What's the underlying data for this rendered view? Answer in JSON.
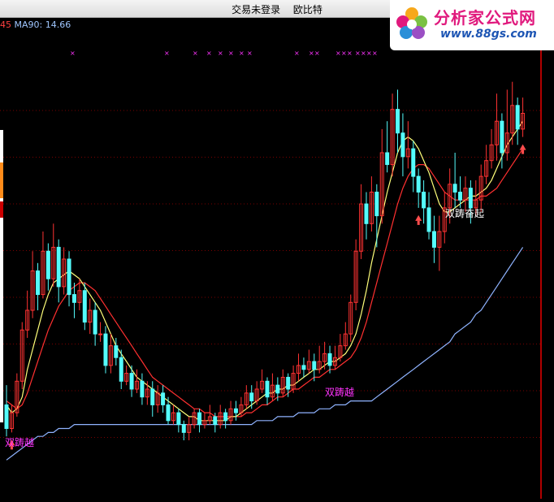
{
  "window": {
    "title_status": "交易未登录",
    "title_stock": "欧比特"
  },
  "indicator": {
    "prev_fragment": "45",
    "ma90_label": "MA90: 14.66"
  },
  "logo": {
    "brand": "分析家公式网",
    "url": "www.88gs.com"
  },
  "signals": {
    "label_a": "双踌越",
    "label_b": "双踌越",
    "label_c": "双踌奋起"
  },
  "colors": {
    "up": "#ff3232",
    "down": "#54fcfc",
    "ma_fast": "#ffff7a",
    "ma_mid": "#ff3030",
    "ma90": "#8fb3ff",
    "marker": "#ff33ff",
    "grid": "#7a0000"
  },
  "chart_data": {
    "type": "candlestick",
    "title": "",
    "xlabel": "",
    "ylabel": "",
    "ylim": [
      0,
      100
    ],
    "grid": true,
    "candles": [
      [
        16,
        10,
        21,
        8
      ],
      [
        10,
        14,
        16,
        9
      ],
      [
        14,
        22,
        24,
        13
      ],
      [
        22,
        35,
        37,
        20
      ],
      [
        35,
        40,
        45,
        33
      ],
      [
        40,
        50,
        55,
        38
      ],
      [
        50,
        44,
        52,
        40
      ],
      [
        44,
        55,
        60,
        43
      ],
      [
        55,
        48,
        57,
        45
      ],
      [
        48,
        56,
        62,
        46
      ],
      [
        56,
        46,
        58,
        42
      ],
      [
        46,
        53,
        56,
        44
      ],
      [
        53,
        44,
        55,
        41
      ],
      [
        44,
        42,
        47,
        38
      ],
      [
        42,
        45,
        48,
        40
      ],
      [
        45,
        37,
        47,
        35
      ],
      [
        37,
        40,
        43,
        34
      ],
      [
        40,
        34,
        42,
        31
      ],
      [
        34,
        34,
        37,
        32
      ],
      [
        34,
        26,
        36,
        24
      ],
      [
        26,
        31,
        34,
        24
      ],
      [
        31,
        28,
        33,
        26
      ],
      [
        28,
        22,
        30,
        20
      ],
      [
        22,
        24,
        26,
        21
      ],
      [
        24,
        20,
        26,
        18
      ],
      [
        20,
        22,
        25,
        19
      ],
      [
        22,
        18,
        24,
        16
      ],
      [
        18,
        20,
        22,
        16
      ],
      [
        20,
        16,
        22,
        13
      ],
      [
        16,
        19,
        21,
        14
      ],
      [
        19,
        16,
        21,
        14
      ],
      [
        16,
        12,
        18,
        11
      ],
      [
        12,
        14,
        16,
        11
      ],
      [
        14,
        11,
        15,
        9
      ],
      [
        11,
        9,
        12,
        7
      ],
      [
        9,
        11,
        13,
        7
      ],
      [
        11,
        14,
        15,
        10
      ],
      [
        14,
        11,
        15,
        9
      ],
      [
        11,
        12,
        14,
        10
      ],
      [
        12,
        13,
        16,
        11
      ],
      [
        13,
        11,
        14,
        9
      ],
      [
        11,
        14,
        16,
        10
      ],
      [
        14,
        12,
        15,
        10
      ],
      [
        12,
        15,
        17,
        11
      ],
      [
        15,
        14,
        17,
        12
      ],
      [
        14,
        16,
        18,
        13
      ],
      [
        16,
        19,
        21,
        15
      ],
      [
        19,
        17,
        21,
        15
      ],
      [
        17,
        20,
        22,
        16
      ],
      [
        20,
        22,
        25,
        19
      ],
      [
        22,
        18,
        23,
        16
      ],
      [
        18,
        21,
        24,
        17
      ],
      [
        21,
        19,
        23,
        17
      ],
      [
        19,
        23,
        25,
        18
      ],
      [
        23,
        20,
        24,
        18
      ],
      [
        20,
        24,
        26,
        19
      ],
      [
        24,
        26,
        29,
        22
      ],
      [
        26,
        25,
        28,
        23
      ],
      [
        25,
        27,
        30,
        24
      ],
      [
        27,
        25,
        29,
        22
      ],
      [
        25,
        27,
        31,
        24
      ],
      [
        27,
        29,
        32,
        25
      ],
      [
        29,
        26,
        31,
        24
      ],
      [
        26,
        28,
        31,
        25
      ],
      [
        28,
        31,
        34,
        27
      ],
      [
        31,
        34,
        37,
        30
      ],
      [
        34,
        42,
        44,
        32
      ],
      [
        42,
        55,
        58,
        40
      ],
      [
        55,
        67,
        72,
        53
      ],
      [
        67,
        62,
        70,
        58
      ],
      [
        62,
        70,
        74,
        60
      ],
      [
        70,
        64,
        72,
        56
      ],
      [
        64,
        80,
        86,
        62
      ],
      [
        80,
        77,
        88,
        75
      ],
      [
        77,
        91,
        95,
        74
      ],
      [
        91,
        85,
        96,
        80
      ],
      [
        85,
        79,
        90,
        74
      ],
      [
        79,
        81,
        88,
        76
      ],
      [
        81,
        74,
        83,
        70
      ],
      [
        74,
        70,
        76,
        66
      ],
      [
        70,
        66,
        73,
        62
      ],
      [
        66,
        60,
        70,
        58
      ],
      [
        60,
        56,
        64,
        52
      ],
      [
        56,
        60,
        64,
        50
      ],
      [
        60,
        66,
        70,
        57
      ],
      [
        66,
        72,
        76,
        62
      ],
      [
        72,
        70,
        80,
        66
      ],
      [
        70,
        68,
        74,
        66
      ],
      [
        68,
        71,
        74,
        65
      ],
      [
        71,
        66,
        73,
        62
      ],
      [
        66,
        68,
        73,
        64
      ],
      [
        68,
        74,
        77,
        65
      ],
      [
        74,
        78,
        82,
        72
      ],
      [
        78,
        82,
        86,
        76
      ],
      [
        82,
        88,
        95,
        78
      ],
      [
        88,
        80,
        90,
        76
      ],
      [
        80,
        85,
        96,
        78
      ],
      [
        85,
        92,
        98,
        82
      ],
      [
        92,
        86,
        94,
        82
      ],
      [
        86,
        90,
        94,
        84
      ]
    ],
    "ma_fast": [
      16,
      14,
      15,
      18,
      25,
      30,
      35,
      40,
      44,
      47,
      48,
      49,
      50,
      49,
      48,
      46,
      44,
      42,
      40,
      37,
      34,
      31,
      29,
      27,
      25,
      23,
      22,
      21,
      20,
      19,
      18,
      17,
      16,
      15,
      14,
      13,
      13,
      12,
      12,
      12,
      12,
      12,
      12,
      13,
      13,
      14,
      15,
      16,
      17,
      18,
      19,
      19,
      20,
      20,
      21,
      21,
      22,
      23,
      24,
      25,
      25,
      26,
      27,
      27,
      28,
      29,
      31,
      34,
      39,
      45,
      52,
      58,
      64,
      70,
      75,
      80,
      83,
      84,
      83,
      81,
      78,
      75,
      71,
      67,
      65,
      65,
      66,
      67,
      68,
      69,
      69,
      70,
      71,
      73,
      76,
      79,
      82,
      84,
      86,
      88
    ],
    "ma_mid": [
      17,
      16,
      15,
      16,
      19,
      23,
      27,
      31,
      35,
      38,
      41,
      43,
      45,
      46,
      47,
      47,
      46,
      45,
      43,
      41,
      39,
      37,
      35,
      33,
      31,
      29,
      27,
      25,
      23,
      22,
      21,
      20,
      19,
      18,
      17,
      16,
      15,
      15,
      14,
      14,
      13,
      13,
      13,
      13,
      13,
      13,
      14,
      14,
      15,
      16,
      16,
      17,
      18,
      18,
      19,
      20,
      20,
      21,
      22,
      23,
      23,
      24,
      25,
      25,
      26,
      27,
      28,
      30,
      33,
      37,
      42,
      47,
      52,
      57,
      62,
      67,
      71,
      74,
      76,
      77,
      77,
      76,
      74,
      72,
      70,
      69,
      68,
      68,
      68,
      68,
      68,
      69,
      69,
      70,
      71,
      73,
      75,
      77,
      79,
      81
    ],
    "ma90": [
      2,
      3,
      4,
      5,
      6,
      7,
      8,
      8,
      9,
      9,
      10,
      10,
      10,
      11,
      11,
      11,
      11,
      11,
      11,
      11,
      11,
      11,
      11,
      11,
      11,
      11,
      11,
      11,
      11,
      11,
      11,
      11,
      11,
      11,
      11,
      11,
      11,
      11,
      11,
      11,
      11,
      11,
      11,
      11,
      11,
      11,
      11,
      11,
      12,
      12,
      12,
      12,
      13,
      13,
      13,
      13,
      14,
      14,
      14,
      14,
      15,
      15,
      15,
      16,
      16,
      16,
      17,
      17,
      17,
      17,
      17,
      18,
      19,
      20,
      21,
      22,
      23,
      24,
      25,
      26,
      27,
      28,
      29,
      30,
      31,
      32,
      34,
      35,
      36,
      37,
      39,
      40,
      42,
      44,
      46,
      48,
      50,
      52,
      54,
      56
    ],
    "up_markers": [
      1,
      79,
      108
    ]
  }
}
